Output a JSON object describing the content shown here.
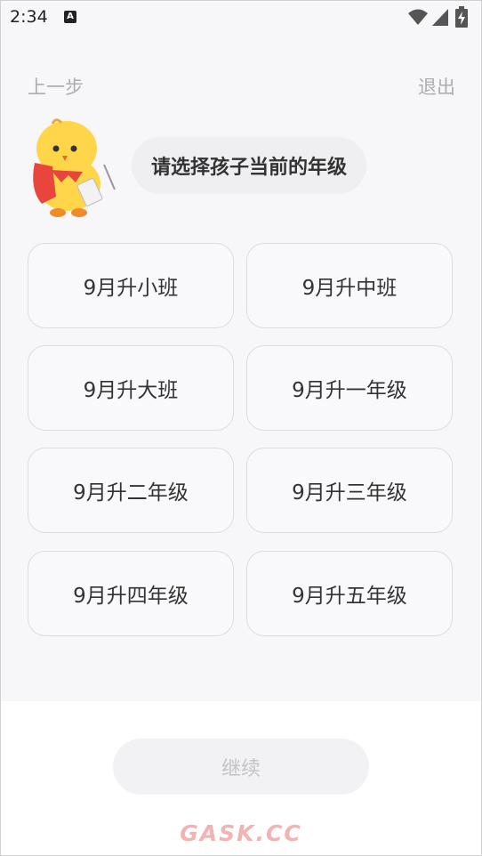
{
  "status_bar": {
    "time": "2:34",
    "notification_letter": "A"
  },
  "nav": {
    "back_label": "上一步",
    "exit_label": "退出"
  },
  "prompt": "请选择孩子当前的年级",
  "grades": [
    "9月升小班",
    "9月升中班",
    "9月升大班",
    "9月升一年级",
    "9月升二年级",
    "9月升三年级",
    "9月升四年级",
    "9月升五年级"
  ],
  "continue_label": "继续",
  "watermark": "GASK.CC",
  "colors": {
    "page_bg": "#f7f7f9",
    "option_border": "#dcdce0",
    "disabled_text": "#c3c3c3",
    "mascot_yellow": "#ffd54a",
    "mascot_red": "#e8453c"
  },
  "icons": [
    "wifi-icon",
    "cell-signal-icon",
    "battery-charging-icon",
    "mascot-chick"
  ]
}
